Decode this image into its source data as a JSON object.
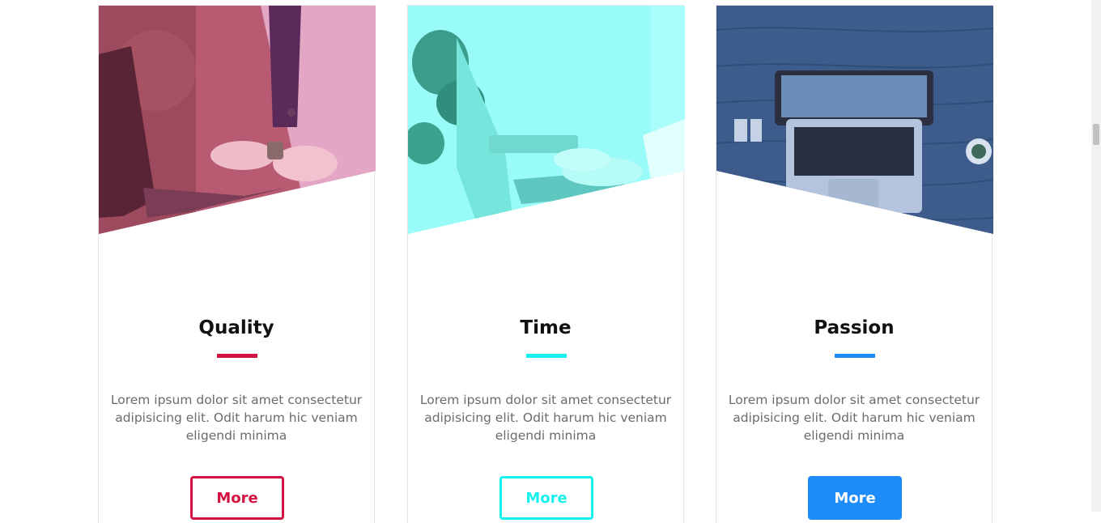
{
  "colors": {
    "quality": "#d21341",
    "time": "#18f0ee",
    "passion": "#1e8cf8",
    "text": "#6b6b6b",
    "title": "#111111"
  },
  "cards": [
    {
      "title": "Quality",
      "text": "Lorem ipsum dolor sit amet consectetur adipisicing elit. Odit harum hic veniam eligendi minima",
      "button": "More",
      "image": "woman-typing-on-laptop-photo"
    },
    {
      "title": "Time",
      "text": "Lorem ipsum dolor sit amet consectetur adipisicing elit. Odit harum hic veniam eligendi minima",
      "button": "More",
      "image": "hands-typing-with-plant-photo"
    },
    {
      "title": "Passion",
      "text": "Lorem ipsum dolor sit amet consectetur adipisicing elit. Odit harum hic veniam eligendi minima",
      "button": "More",
      "image": "laptop-on-wooden-desk-photo"
    }
  ]
}
